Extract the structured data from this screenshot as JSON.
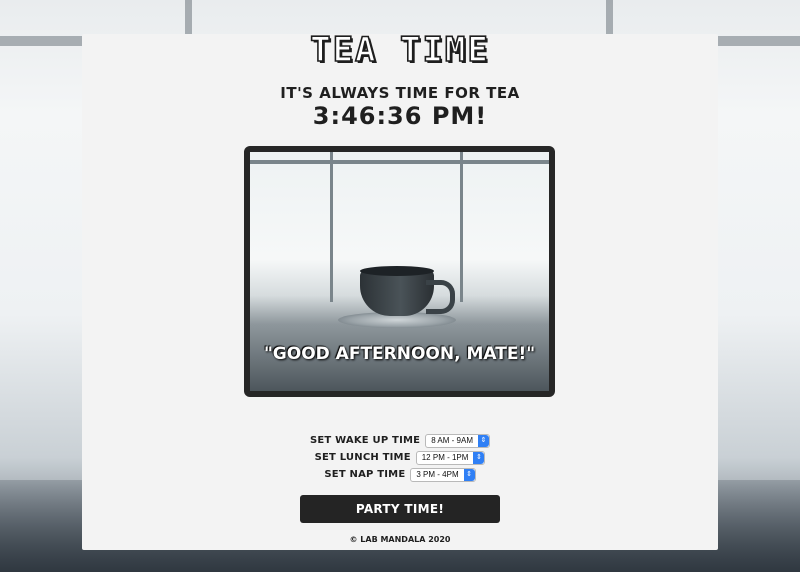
{
  "header": {
    "title": "TEA TIME",
    "subtitle": "IT'S ALWAYS TIME FOR TEA",
    "clock": "3:46:36 PM!"
  },
  "photo": {
    "quote": "\"GOOD AFTERNOON, MATE!\""
  },
  "settings": {
    "wake": {
      "label": "SET WAKE UP TIME",
      "value": "8 AM - 9AM"
    },
    "lunch": {
      "label": "SET LUNCH TIME",
      "value": "12 PM - 1PM"
    },
    "nap": {
      "label": "SET NAP TIME",
      "value": "3 PM - 4PM"
    }
  },
  "button": {
    "label": "PARTY TIME!"
  },
  "footer": {
    "text": "© LAB MANDALA 2020"
  },
  "colors": {
    "panel": "#f3f3f3",
    "button": "#242424",
    "select_arrow": "#2f7ff5"
  }
}
